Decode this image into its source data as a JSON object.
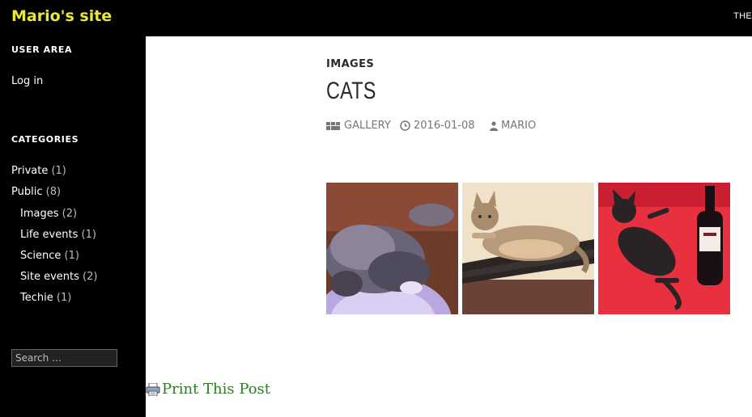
{
  "header": {
    "site_title": "Mario's site",
    "nav_text": "THE"
  },
  "sidebar": {
    "user_area_title": "USER AREA",
    "login_label": "Log in",
    "categories_title": "CATEGORIES",
    "categories": [
      {
        "label": "Private",
        "count": "(1)"
      },
      {
        "label": "Public",
        "count": "(8)"
      },
      {
        "label": "Images",
        "count": "(2)"
      },
      {
        "label": "Life events",
        "count": "(1)"
      },
      {
        "label": "Science",
        "count": "(1)"
      },
      {
        "label": "Site events",
        "count": "(2)"
      },
      {
        "label": "Techie",
        "count": "(1)"
      }
    ],
    "search_placeholder": "Search …"
  },
  "post": {
    "category": "IMAGES",
    "title": "CATS",
    "format": "GALLERY",
    "date": "2016-01-08",
    "author": "MARIO"
  },
  "gallery": [
    {
      "icon": "fluffy-cat-photo"
    },
    {
      "icon": "tabby-cat-photo"
    },
    {
      "icon": "black-cat-with-wine-photo"
    }
  ],
  "print_label": "Print This Post",
  "colors": {
    "title": "#e8e837",
    "link_green": "#2a7f22",
    "meta_gray": "#767676"
  }
}
